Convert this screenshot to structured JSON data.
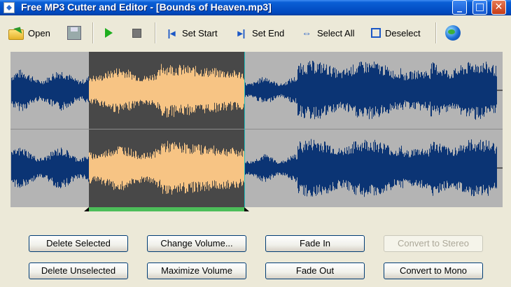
{
  "window": {
    "title": "Free MP3 Cutter and Editor - [Bounds of Heaven.mp3]"
  },
  "title_controls": {
    "minimize": "_",
    "maximize": "□",
    "close": "✕"
  },
  "toolbar": {
    "open": "Open",
    "set_start": "Set Start",
    "set_end": "Set End",
    "select_all": "Select All",
    "deselect": "Deselect",
    "icons": [
      "folder-open-icon",
      "save-icon",
      "play-icon",
      "stop-icon",
      "set-start-icon",
      "set-end-icon",
      "select-all-icon",
      "deselect-icon",
      "globe-icon"
    ]
  },
  "actions": {
    "delete_selected": "Delete Selected",
    "delete_unselected": "Delete Unselected",
    "change_volume": "Change Volume...",
    "maximize_volume": "Maximize Volume",
    "fade_in": "Fade In",
    "fade_out": "Fade Out",
    "convert_stereo": "Convert to Stereo",
    "convert_mono": "Convert to Mono"
  },
  "colors": {
    "wave_unselected": "#0b3474",
    "wave_selected": "#f7c484",
    "selection_bg": "#484848",
    "wave_bg": "#b4b4b4",
    "selection_marker": "#4cbd59"
  }
}
